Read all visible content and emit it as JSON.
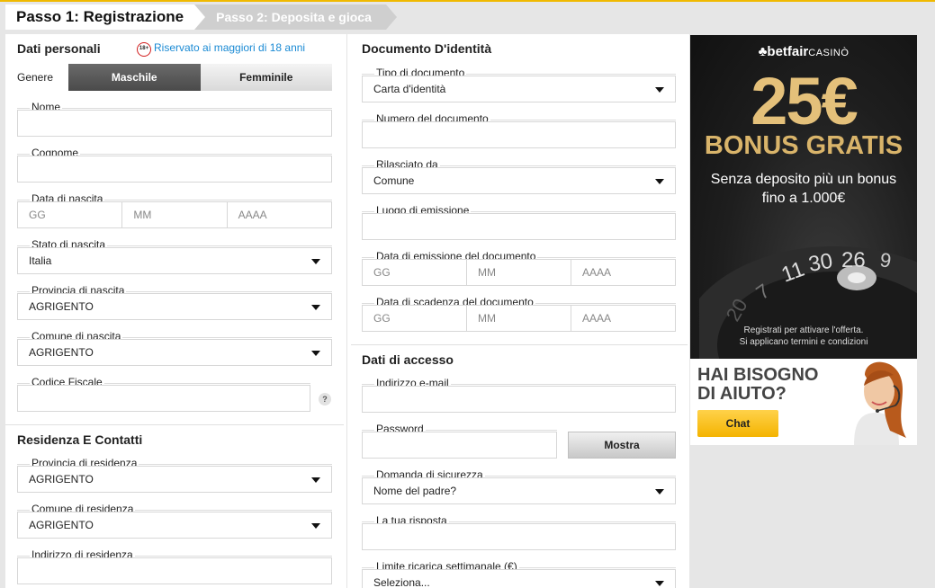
{
  "steps": {
    "step1": "Passo 1: Registrazione",
    "step2": "Passo 2: Deposita e gioca"
  },
  "personal": {
    "title": "Dati personali",
    "age_badge": "18+",
    "age_note": "Riservato ai maggiori di 18 anni",
    "gender_label": "Genere",
    "gender_male": "Maschile",
    "gender_female": "Femminile",
    "nome_label": "Nome",
    "cognome_label": "Cognome",
    "birthdate_label": "Data di nascita",
    "day_ph": "GG",
    "month_ph": "MM",
    "year_ph": "AAAA",
    "birth_state_label": "Stato di nascita",
    "birth_state_value": "Italia",
    "birth_province_label": "Provincia di nascita",
    "birth_province_value": "AGRIGENTO",
    "birth_city_label": "Comune di nascita",
    "birth_city_value": "AGRIGENTO",
    "fiscal_code_label": "Codice Fiscale",
    "help_icon": "?"
  },
  "residence": {
    "title": "Residenza E Contatti",
    "province_label": "Provincia di residenza",
    "province_value": "AGRIGENTO",
    "city_label": "Comune di residenza",
    "city_value": "AGRIGENTO",
    "address_label": "Indirizzo di residenza"
  },
  "document": {
    "title": "Documento D'identità",
    "type_label": "Tipo di documento",
    "type_value": "Carta d'identità",
    "number_label": "Numero del documento",
    "issuer_label": "Rilasciato da",
    "issuer_value": "Comune",
    "place_label": "Luogo di emissione",
    "issue_date_label": "Data di emissione del documento",
    "expiry_date_label": "Data di scadenza del documento",
    "day_ph": "GG",
    "month_ph": "MM",
    "year_ph": "AAAA"
  },
  "access": {
    "title": "Dati di accesso",
    "email_label": "Indirizzo e-mail",
    "password_label": "Password",
    "show_button": "Mostra",
    "security_question_label": "Domanda di sicurezza",
    "security_question_value": "Nome del padre?",
    "answer_label": "La tua risposta",
    "weekly_limit_label": "Limite ricarica settimanale (€)",
    "weekly_limit_value": "Seleziona..."
  },
  "ad": {
    "logo_brand": "betfair",
    "logo_suffix": "CASINÒ",
    "amount": "25€",
    "bonus": "BONUS GRATIS",
    "sub_line1": "Senza deposito più un bonus",
    "sub_line2": "fino a 1.000€",
    "terms_line1": "Registrati per attivare l'offerta.",
    "terms_line2": "Si applicano termini e condizioni",
    "wheel_numbers": [
      "20",
      "7",
      "11",
      "30",
      "26",
      "9"
    ]
  },
  "help": {
    "title_line1": "HAI BISOGNO",
    "title_line2": "DI AIUTO?",
    "chat_button": "Chat"
  },
  "colors": {
    "accent": "#f0b900",
    "link": "#1a8ad4",
    "gold": "#e4c07a",
    "chat": "#f4b400"
  }
}
